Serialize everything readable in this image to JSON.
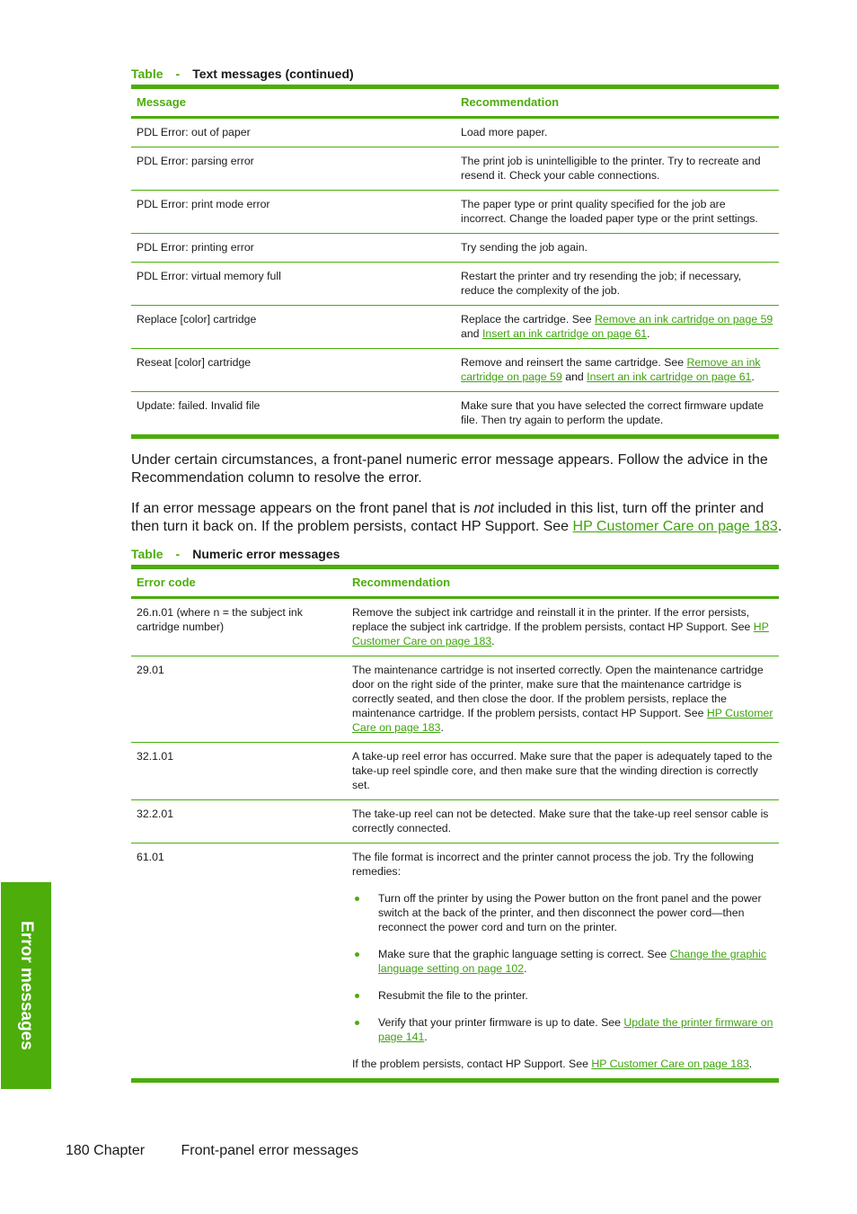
{
  "table1": {
    "label": "Table",
    "dash": "-",
    "title": "Text messages (continued)",
    "headers": [
      "Message",
      "Recommendation"
    ],
    "rows": [
      {
        "message": "PDL Error: out of paper",
        "rec": [
          {
            "t": "Load more paper."
          }
        ]
      },
      {
        "message": "PDL Error: parsing error",
        "rec": [
          {
            "t": "The print job is unintelligible to the printer. Try to recreate and resend it. Check your cable connections."
          }
        ]
      },
      {
        "message": "PDL Error: print mode error",
        "rec": [
          {
            "t": "The paper type or print quality specified for the job are incorrect. Change the loaded paper type or the print settings."
          }
        ]
      },
      {
        "message": "PDL Error: printing error",
        "rec": [
          {
            "t": "Try sending the job again."
          }
        ]
      },
      {
        "message": "PDL Error: virtual memory full",
        "rec": [
          {
            "t": "Restart the printer and try resending the job; if necessary, reduce the complexity of the job."
          }
        ]
      },
      {
        "message": "Replace [color] cartridge",
        "rec": [
          {
            "t": "Replace the cartridge. See "
          },
          {
            "link": "Remove an ink cartridge on page 59"
          },
          {
            "t": " and "
          },
          {
            "link": "Insert an ink cartridge on page 61"
          },
          {
            "t": "."
          }
        ]
      },
      {
        "message": "Reseat [color] cartridge",
        "rec": [
          {
            "t": "Remove and reinsert the same cartridge. See "
          },
          {
            "link": "Remove an ink cartridge on page 59"
          },
          {
            "t": " and "
          },
          {
            "link": "Insert an ink cartridge on page 61"
          },
          {
            "t": "."
          }
        ]
      },
      {
        "message": "Update: failed. Invalid file",
        "rec": [
          {
            "t": "Make sure that you have selected the correct firmware update file. Then try again to perform the update."
          }
        ]
      }
    ]
  },
  "paragraph1": "Under certain circumstances, a front-panel numeric error message appears. Follow the advice in the Recommendation column to resolve the error.",
  "paragraph2": {
    "before": "If an error message appears on the front panel that is ",
    "emph": "not",
    "after": " included in this list, turn off the printer and then turn it back on. If the problem persists, contact HP Support. See ",
    "link": "HP Customer Care on page 183",
    "end": "."
  },
  "table2": {
    "label": "Table",
    "dash": "-",
    "title": "Numeric error messages",
    "headers": [
      "Error code",
      "Recommendation"
    ],
    "rows": [
      {
        "code": "26.n.01 (where n = the subject ink cartridge number)",
        "rec": [
          {
            "t": "Remove the subject ink cartridge and reinstall it in the printer. If the error persists, replace the subject ink cartridge. If the problem persists, contact HP Support. See "
          },
          {
            "link": "HP Customer Care on page 183"
          },
          {
            "t": "."
          }
        ]
      },
      {
        "code": "29.01",
        "rec": [
          {
            "t": "The maintenance cartridge is not inserted correctly. Open the maintenance cartridge door on the right side of the printer, make sure that the maintenance cartridge is correctly seated, and then close the door. If the problem persists, replace the maintenance cartridge. If the problem persists, contact HP Support. See "
          },
          {
            "link": "HP Customer Care on page 183"
          },
          {
            "t": "."
          }
        ]
      },
      {
        "code": "32.1.01",
        "rec": [
          {
            "t": "A take-up reel error has occurred. Make sure that the paper is adequately taped to the take-up reel spindle core, and then make sure that the winding direction is correctly set."
          }
        ]
      },
      {
        "code": "32.2.01",
        "rec": [
          {
            "t": "The take-up reel can not be detected. Make sure that the take-up reel sensor cable is correctly connected."
          }
        ]
      }
    ],
    "last_row": {
      "code": "61.01",
      "intro": "The file format is incorrect and the printer cannot process the job. Try the following remedies:",
      "bullets": [
        [
          {
            "t": "Turn off the printer by using the Power button on the front panel and the power switch at the back of the printer, and then disconnect the power cord—then reconnect the power cord and turn on the printer."
          }
        ],
        [
          {
            "t": "Make sure that the graphic language setting is correct. See "
          },
          {
            "link": "Change the graphic language setting on page 102"
          },
          {
            "t": "."
          }
        ],
        [
          {
            "t": "Resubmit the file to the printer."
          }
        ],
        [
          {
            "t": "Verify that your printer firmware is up to date. See "
          },
          {
            "link": "Update the printer firmware on page 141"
          },
          {
            "t": "."
          }
        ]
      ],
      "outro": [
        {
          "t": "If the problem persists, contact HP Support. See "
        },
        {
          "link": "HP Customer Care on page 183"
        },
        {
          "t": "."
        }
      ]
    }
  },
  "side_tab": "Error messages",
  "footer": {
    "page": "180",
    "chapter": "Chapter",
    "title": "Front-panel error messages"
  },
  "colors": {
    "accent": "#4cad0b",
    "link": "#3fa30e"
  }
}
